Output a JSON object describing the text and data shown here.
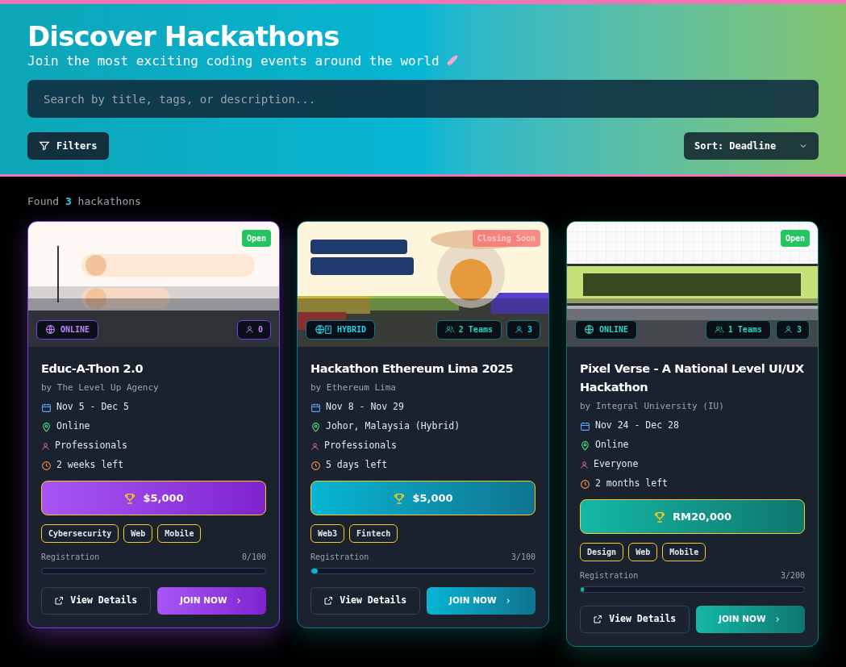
{
  "header": {
    "title": "Discover Hackathons",
    "subtitle": "Join the most exciting coding events around the world",
    "search": {
      "placeholder": "Search by title, tags, or description..."
    },
    "filters_button": "Filters",
    "sort": {
      "value": "Sort: Deadline"
    }
  },
  "results": {
    "prefix": "Found",
    "count": "3",
    "suffix": "hackathons"
  },
  "cards": [
    {
      "color": "#7c3aed",
      "status": {
        "label": "Open",
        "kind": "open"
      },
      "mode": {
        "label": "ONLINE",
        "kind": "online"
      },
      "participants": "0",
      "title": "Educ-A-Thon 2.0",
      "organizer": "by The Level Up Agency",
      "dates": "Nov 5 - Dec 5",
      "location": "Online",
      "audience": "Professionals",
      "time_left": "2 weeks left",
      "prize": "$5,000",
      "tags": [
        "Cybersecurity",
        "Web",
        "Mobile"
      ],
      "registration": {
        "label": "Registration",
        "count": "0/100",
        "level": 0
      },
      "details_button": "View Details",
      "join_button": "JOIN NOW"
    },
    {
      "color": "#0e7490",
      "status": {
        "label": "Closing Soon",
        "kind": "closing"
      },
      "mode": {
        "label": "HYBRID",
        "kind": "hybrid"
      },
      "teams": "2 Teams",
      "participants": "3",
      "title": "Hackathon Ethereum Lima 2025",
      "organizer": "by Ethereum Lima",
      "dates": "Nov 8 - Nov 29",
      "location": "Johor, Malaysia (Hybrid)",
      "audience": "Professionals",
      "time_left": "5 days left",
      "prize": "$5,000",
      "tags": [
        "Web3",
        "Fintech"
      ],
      "registration": {
        "label": "Registration",
        "count": "3/100",
        "level": 0.03
      },
      "details_button": "View Details",
      "join_button": "JOIN NOW"
    },
    {
      "color": "#0f766e",
      "status": {
        "label": "Open",
        "kind": "open"
      },
      "mode": {
        "label": "ONLINE",
        "kind": "online"
      },
      "teams": "1 Teams",
      "participants": "3",
      "title": "Pixel Verse - A National Level UI/UX Hackathon",
      "organizer": "by Integral University (IU)",
      "dates": "Nov 24 - Dec 28",
      "location": "Online",
      "audience": "Everyone",
      "time_left": "2 months left",
      "prize": "RM20,000",
      "tags": [
        "Design",
        "Web",
        "Mobile"
      ],
      "registration": {
        "label": "Registration",
        "count": "3/200",
        "level": 0.015
      },
      "details_button": "View Details",
      "join_button": "JOIN NOW"
    }
  ]
}
